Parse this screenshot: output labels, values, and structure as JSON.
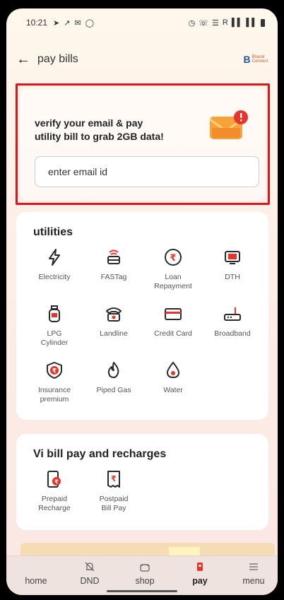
{
  "status": {
    "time": "10:21",
    "left_icons": [
      "send-icon",
      "missed-call-icon",
      "message-icon",
      "shield-icon"
    ],
    "right_text": "R"
  },
  "header": {
    "title": "pay bills",
    "brand_top": "Bharat",
    "brand_bottom": "Connect"
  },
  "email_card": {
    "message_line1": "verify your email & pay",
    "message_line2": "utility bill to grab 2GB data!",
    "input_placeholder": "enter email id",
    "input_value": ""
  },
  "utilities": {
    "heading": "utilities",
    "items": [
      {
        "label1": "Electricity",
        "label2": "",
        "icon": "lightning-icon"
      },
      {
        "label1": "FASTag",
        "label2": "",
        "icon": "fastag-icon"
      },
      {
        "label1": "Loan",
        "label2": "Repayment",
        "icon": "rupee-coin-icon"
      },
      {
        "label1": "DTH",
        "label2": "",
        "icon": "tv-icon"
      },
      {
        "label1": "LPG",
        "label2": "Cylinder",
        "icon": "gas-cylinder-icon"
      },
      {
        "label1": "Landline",
        "label2": "",
        "icon": "telephone-icon"
      },
      {
        "label1": "Credit Card",
        "label2": "",
        "icon": "credit-card-icon"
      },
      {
        "label1": "Broadband",
        "label2": "",
        "icon": "router-icon"
      },
      {
        "label1": "Insurance",
        "label2": "premium",
        "icon": "insurance-shield-icon"
      },
      {
        "label1": "Piped Gas",
        "label2": "",
        "icon": "flame-icon"
      },
      {
        "label1": "Water",
        "label2": "",
        "icon": "water-drop-icon"
      }
    ]
  },
  "vi": {
    "heading": "Vi bill pay and recharges",
    "items": [
      {
        "label1": "Prepaid",
        "label2": "Recharge",
        "icon": "prepaid-recharge-icon"
      },
      {
        "label1": "Postpaid",
        "label2": "Bill Pay",
        "icon": "postpaid-bill-icon"
      }
    ]
  },
  "nav": {
    "items": [
      {
        "label": "home",
        "icon": "home-icon"
      },
      {
        "label": "DND",
        "icon": "bell-off-icon"
      },
      {
        "label": "shop",
        "icon": "shop-icon"
      },
      {
        "label": "pay",
        "icon": "pay-icon"
      },
      {
        "label": "menu",
        "icon": "menu-icon"
      }
    ],
    "active": "pay"
  },
  "colors": {
    "accent": "#e8352c",
    "highlight_border": "#e0141a",
    "icon_dark": "#2a2a2a",
    "icon_red": "#e8352c"
  }
}
